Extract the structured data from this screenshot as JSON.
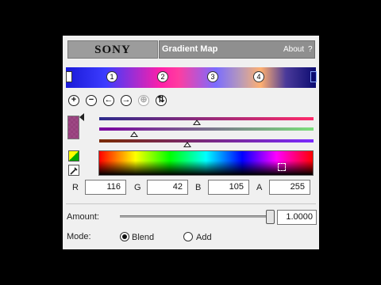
{
  "header": {
    "brand": "SONY",
    "title": "Gradient Map",
    "about_label": "About",
    "help_label": "?"
  },
  "gradient": {
    "stops": [
      "1",
      "2",
      "3",
      "4"
    ]
  },
  "toolbar": {
    "icons": [
      "add-icon",
      "remove-icon",
      "move-left-icon",
      "move-right-icon",
      "duplicate-icon",
      "reverse-icon"
    ],
    "add_glyph": "+",
    "remove_glyph": "−",
    "left_glyph": "←",
    "right_glyph": "→",
    "dup_glyph": "⊕",
    "reverse_glyph": "⇅"
  },
  "color": {
    "swatch": "#8c286e",
    "r_label": "R",
    "g_label": "G",
    "b_label": "B",
    "a_label": "A",
    "r": "116",
    "g": "42",
    "b": "105",
    "a": "255"
  },
  "amount": {
    "label": "Amount:",
    "value": "1.0000"
  },
  "mode": {
    "label": "Mode:",
    "options": [
      "Blend",
      "Add"
    ],
    "selected": "Blend"
  }
}
